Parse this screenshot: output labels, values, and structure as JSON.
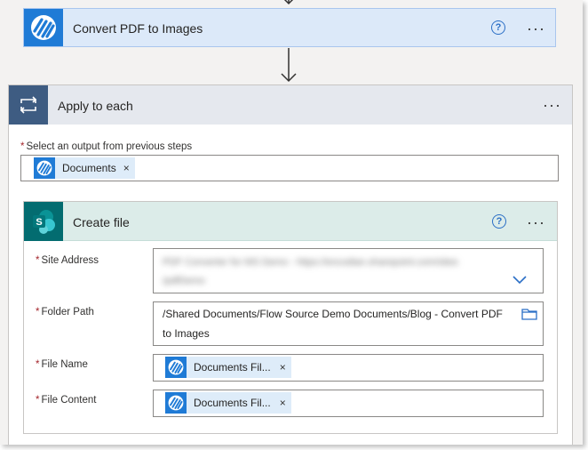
{
  "convert_step": {
    "title": "Convert PDF to Images",
    "help_glyph": "?",
    "more_glyph": "···",
    "icon": "stripes-connector-icon",
    "accent": "#1f7bd6"
  },
  "apply_each": {
    "title": "Apply to each",
    "more_glyph": "···",
    "icon": "loop-icon",
    "accent": "#3e5c82",
    "output_label": "Select an output from previous steps",
    "output_token": "Documents",
    "token_remove": "×"
  },
  "create_file": {
    "title": "Create file",
    "help_glyph": "?",
    "more_glyph": "···",
    "icon": "sharepoint-icon",
    "accent": "#036c70",
    "required_mark": "*",
    "site_address": {
      "label": "Site Address",
      "value_line1": "PDF Converter for MS Demo - https://encodian.sharepoint.com/sites",
      "value_line2": "/pdfDemo"
    },
    "folder_path": {
      "label": "Folder Path",
      "value_line1": "/Shared Documents/Flow Source Demo Documents/Blog - Convert PDF",
      "value_line2": "to Images"
    },
    "file_name": {
      "label": "File Name",
      "token": "Documents Fil..."
    },
    "file_content": {
      "label": "File Content",
      "token": "Documents Fil..."
    },
    "token_remove": "×"
  }
}
